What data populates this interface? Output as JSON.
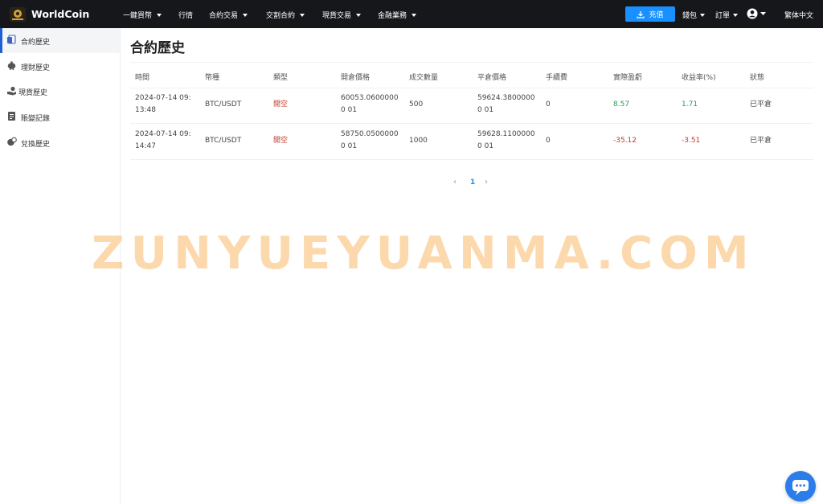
{
  "header": {
    "brand": "WorldCoin",
    "nav": [
      {
        "label": "一鍵買幣",
        "has_dropdown": true
      },
      {
        "label": "行情",
        "has_dropdown": false
      },
      {
        "label": "合約交易",
        "has_dropdown": true
      },
      {
        "label": "交割合約",
        "has_dropdown": true
      },
      {
        "label": "現貨交易",
        "has_dropdown": true
      },
      {
        "label": "金融業務",
        "has_dropdown": true
      }
    ],
    "deposit_label": "充值",
    "wallet_label": "錢包",
    "orders_label": "訂單",
    "language_label": "繁体中文",
    "accent_color": "#1890ff"
  },
  "sidebar": {
    "items": [
      {
        "label": "合約歷史",
        "icon": "contract-history-icon",
        "active": true
      },
      {
        "label": "理財歷史",
        "icon": "finance-icon",
        "active": false
      },
      {
        "label": "現貨歷史",
        "icon": "spot-icon",
        "active": false
      },
      {
        "label": "賬變記錄",
        "icon": "record-icon",
        "active": false
      },
      {
        "label": "兌換歷史",
        "icon": "exchange-icon",
        "active": false
      }
    ]
  },
  "main": {
    "title": "合約歷史",
    "columns": [
      "時間",
      "幣種",
      "類型",
      "開倉價格",
      "成交數量",
      "平倉價格",
      "手續費",
      "實際盈虧",
      "收益率(%)",
      "狀態"
    ],
    "rows": [
      {
        "time": "2024-07-14 09:13:48",
        "symbol": "BTC/USDT",
        "type": "開空",
        "open_price": "60053.06000000 01",
        "quantity": "500",
        "close_price": "59624.38000000 01",
        "fee": "0",
        "pnl": "8.57",
        "yield": "1.71",
        "status": "已平倉"
      },
      {
        "time": "2024-07-14 09:14:47",
        "symbol": "BTC/USDT",
        "type": "開空",
        "open_price": "58750.05000000 01",
        "quantity": "1000",
        "close_price": "59628.11000000 01",
        "fee": "0",
        "pnl": "-35.12",
        "yield": "-3.51",
        "status": "已平倉"
      }
    ],
    "pagination": {
      "current": "1",
      "prev": "‹",
      "next": "›"
    }
  },
  "watermark": "ZUNYUEYUANMA.COM",
  "colors": {
    "positive": "#1e9e5a",
    "negative": "#c0392b",
    "topbar": "#16171b"
  }
}
